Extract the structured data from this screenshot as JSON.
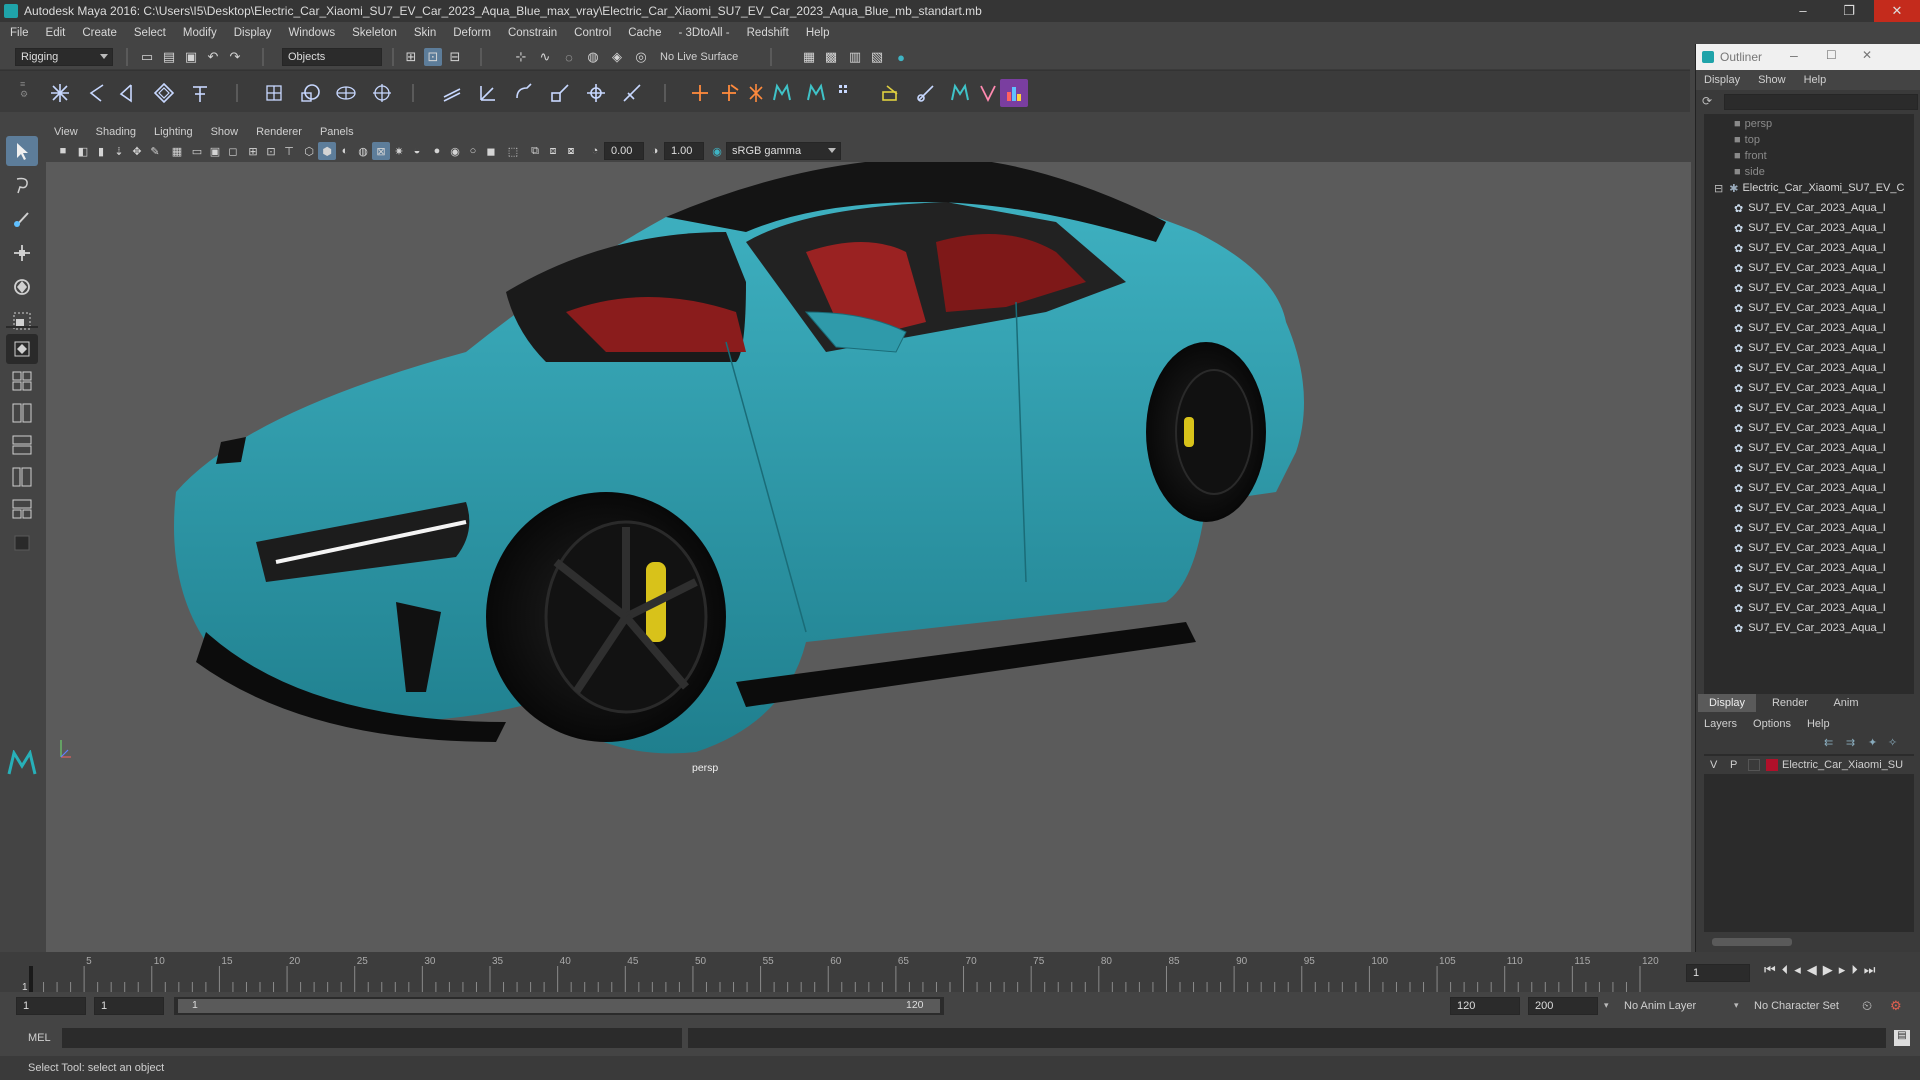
{
  "window": {
    "title": "Autodesk Maya 2016: C:\\Users\\I5\\Desktop\\Electric_Car_Xiaomi_SU7_EV_Car_2023_Aqua_Blue_max_vray\\Electric_Car_Xiaomi_SU7_EV_Car_2023_Aqua_Blue_mb_standart.mb",
    "minimize": "–",
    "restore": "❐",
    "close": "✕"
  },
  "menubar": [
    "File",
    "Edit",
    "Create",
    "Select",
    "Modify",
    "Display",
    "Windows",
    "Skeleton",
    "Skin",
    "Deform",
    "Constrain",
    "Control",
    "Cache",
    "- 3DtoAll -",
    "Redshift",
    "Help"
  ],
  "statusline": {
    "mode": "Rigging",
    "selection_mode": "Objects",
    "live_surface": "No Live Surface"
  },
  "viewport": {
    "menu": [
      "View",
      "Shading",
      "Lighting",
      "Show",
      "Renderer",
      "Panels"
    ],
    "field_exposure": "0.00",
    "field_gamma": "1.00",
    "color_space": "sRGB gamma",
    "camera_label": "persp",
    "colors": {
      "body": "#2f9aaa",
      "background": "#5b5b5b",
      "interior": "#8a1c1c",
      "caliper": "#d8c21a"
    }
  },
  "outliner": {
    "title": "Outliner",
    "menu": [
      "Display",
      "Show",
      "Help"
    ],
    "cameras": [
      "persp",
      "top",
      "front",
      "side"
    ],
    "root": "Electric_Car_Xiaomi_SU7_EV_C",
    "children": [
      "SU7_EV_Car_2023_Aqua_I",
      "SU7_EV_Car_2023_Aqua_I",
      "SU7_EV_Car_2023_Aqua_I",
      "SU7_EV_Car_2023_Aqua_I",
      "SU7_EV_Car_2023_Aqua_I",
      "SU7_EV_Car_2023_Aqua_I",
      "SU7_EV_Car_2023_Aqua_I",
      "SU7_EV_Car_2023_Aqua_I",
      "SU7_EV_Car_2023_Aqua_I",
      "SU7_EV_Car_2023_Aqua_I",
      "SU7_EV_Car_2023_Aqua_I",
      "SU7_EV_Car_2023_Aqua_I",
      "SU7_EV_Car_2023_Aqua_I",
      "SU7_EV_Car_2023_Aqua_I",
      "SU7_EV_Car_2023_Aqua_I",
      "SU7_EV_Car_2023_Aqua_I",
      "SU7_EV_Car_2023_Aqua_I",
      "SU7_EV_Car_2023_Aqua_I",
      "SU7_EV_Car_2023_Aqua_I",
      "SU7_EV_Car_2023_Aqua_I",
      "SU7_EV_Car_2023_Aqua_I",
      "SU7_EV_Car_2023_Aqua_I"
    ]
  },
  "layers": {
    "tabs": [
      "Display",
      "Render",
      "Anim"
    ],
    "menu": [
      "Layers",
      "Options",
      "Help"
    ],
    "row": {
      "v": "V",
      "p": "P",
      "name": "Electric_Car_Xiaomi_SU",
      "color": "#b0102a"
    }
  },
  "timeline": {
    "ticks": [
      "5",
      "10",
      "15",
      "20",
      "25",
      "30",
      "35",
      "40",
      "45",
      "50",
      "55",
      "60",
      "65",
      "70",
      "75",
      "80",
      "85",
      "90",
      "95",
      "100",
      "105",
      "110",
      "115",
      "120"
    ],
    "start_tick": "1",
    "current_frame": "1"
  },
  "range": {
    "start": "1",
    "playback_start": "1",
    "slider_start": "1",
    "slider_end": "120",
    "playback_end": "120",
    "end": "200",
    "anim_layer": "No Anim Layer",
    "character_set": "No Character Set"
  },
  "command": {
    "label": "MEL"
  },
  "helpline": "Select Tool: select an object"
}
